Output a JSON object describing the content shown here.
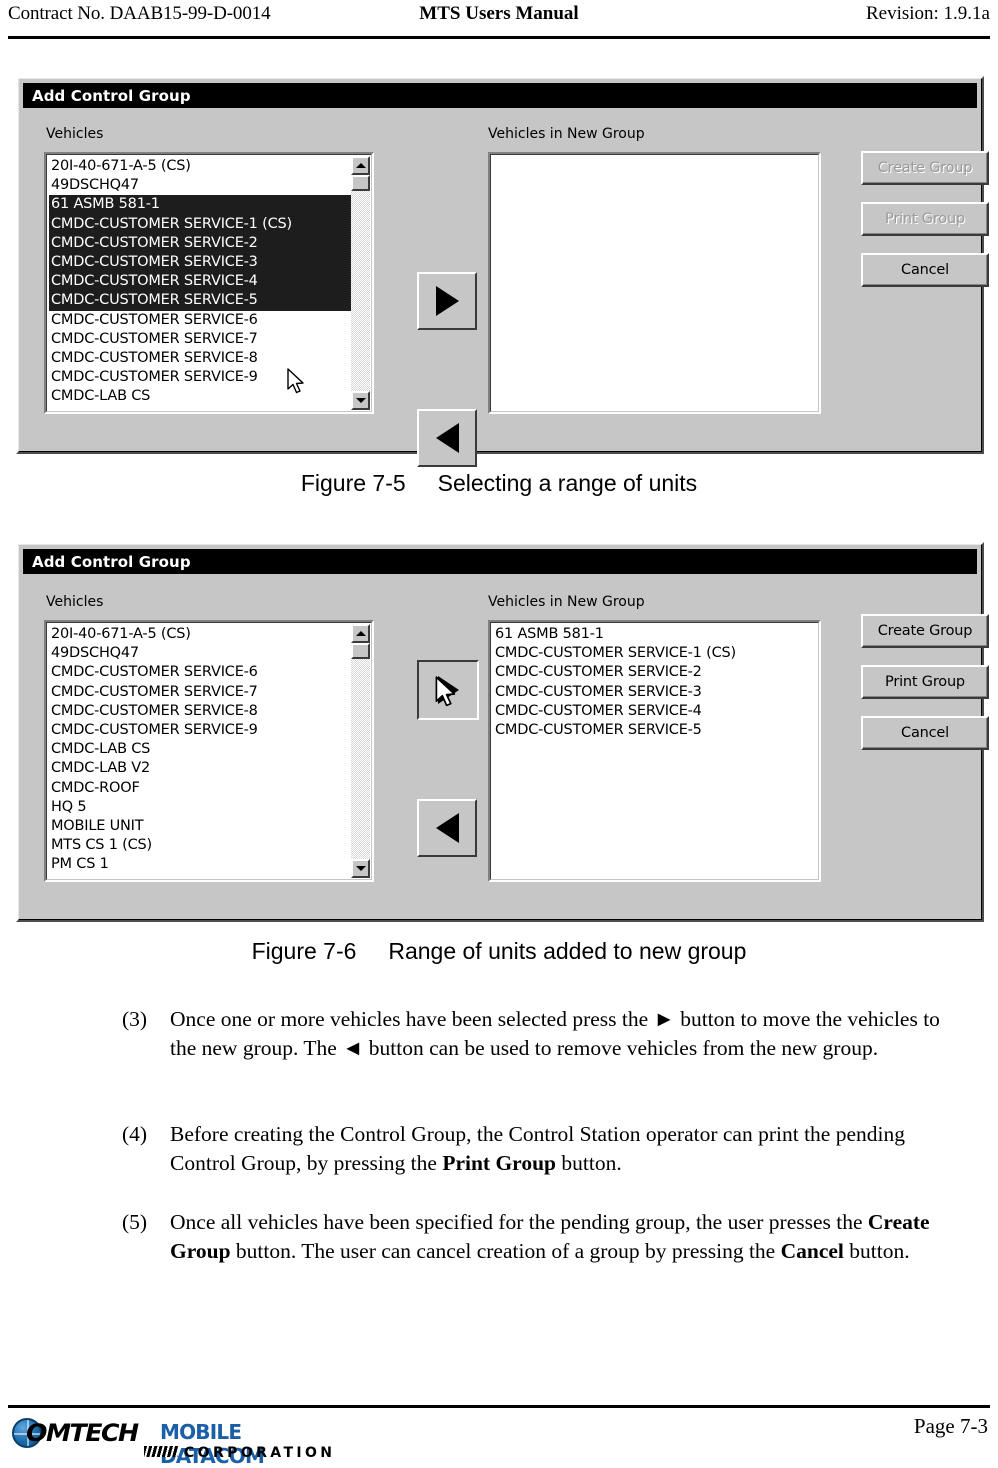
{
  "header": {
    "left": "Contract No. DAAB15-99-D-0014",
    "center": "MTS Users Manual",
    "right": "Revision:  1.9.1a"
  },
  "figure1": {
    "title": "Add Control Group",
    "left_label": "Vehicles",
    "right_label": "Vehicles in New Group",
    "left_items": [
      {
        "text": "20I-40-671-A-5 (CS)",
        "selected": false
      },
      {
        "text": "49DSCHQ47",
        "selected": false
      },
      {
        "text": "61 ASMB 581-1",
        "selected": true
      },
      {
        "text": "CMDC-CUSTOMER SERVICE-1 (CS)",
        "selected": true
      },
      {
        "text": "CMDC-CUSTOMER SERVICE-2",
        "selected": true
      },
      {
        "text": "CMDC-CUSTOMER SERVICE-3",
        "selected": true
      },
      {
        "text": "CMDC-CUSTOMER SERVICE-4",
        "selected": true
      },
      {
        "text": "CMDC-CUSTOMER SERVICE-5",
        "selected": true
      },
      {
        "text": "CMDC-CUSTOMER SERVICE-6",
        "selected": false
      },
      {
        "text": "CMDC-CUSTOMER SERVICE-7",
        "selected": false
      },
      {
        "text": "CMDC-CUSTOMER SERVICE-8",
        "selected": false
      },
      {
        "text": "CMDC-CUSTOMER SERVICE-9",
        "selected": false
      },
      {
        "text": "CMDC-LAB CS",
        "selected": false
      }
    ],
    "right_items": [],
    "buttons": {
      "create": "Create Group",
      "print": "Print Group",
      "cancel": "Cancel",
      "create_enabled": false,
      "print_enabled": false,
      "cancel_enabled": true
    },
    "move_right_icon": "triangle-right-icon",
    "move_left_icon": "triangle-left-icon",
    "caption": "Figure 7-5     Selecting a range of units"
  },
  "figure2": {
    "title": "Add Control Group",
    "left_label": "Vehicles",
    "right_label": "Vehicles in New Group",
    "left_items": [
      {
        "text": "20I-40-671-A-5 (CS)",
        "selected": false
      },
      {
        "text": "49DSCHQ47",
        "selected": false
      },
      {
        "text": "CMDC-CUSTOMER SERVICE-6",
        "selected": false
      },
      {
        "text": "CMDC-CUSTOMER SERVICE-7",
        "selected": false
      },
      {
        "text": "CMDC-CUSTOMER SERVICE-8",
        "selected": false
      },
      {
        "text": "CMDC-CUSTOMER SERVICE-9",
        "selected": false
      },
      {
        "text": "CMDC-LAB CS",
        "selected": false
      },
      {
        "text": "CMDC-LAB V2",
        "selected": false
      },
      {
        "text": "CMDC-ROOF",
        "selected": false
      },
      {
        "text": "HQ 5",
        "selected": false
      },
      {
        "text": "MOBILE UNIT",
        "selected": false
      },
      {
        "text": "MTS CS 1 (CS)",
        "selected": false
      },
      {
        "text": "PM CS 1",
        "selected": false
      }
    ],
    "right_items": [
      {
        "text": "61 ASMB 581-1",
        "selected": false
      },
      {
        "text": "CMDC-CUSTOMER SERVICE-1 (CS)",
        "selected": false
      },
      {
        "text": "CMDC-CUSTOMER SERVICE-2",
        "selected": false
      },
      {
        "text": "CMDC-CUSTOMER SERVICE-3",
        "selected": false
      },
      {
        "text": "CMDC-CUSTOMER SERVICE-4",
        "selected": false
      },
      {
        "text": "CMDC-CUSTOMER SERVICE-5",
        "selected": false
      }
    ],
    "buttons": {
      "create": "Create Group",
      "print": "Print Group",
      "cancel": "Cancel",
      "create_enabled": true,
      "print_enabled": true,
      "cancel_enabled": true
    },
    "move_right_icon": "triangle-right-icon",
    "move_left_icon": "triangle-left-icon",
    "caption": "Figure 7-6     Range of units added to new group"
  },
  "body": {
    "item3_num": "(3)",
    "item3_text": "Once one or more vehicles have been selected press the ► button to move the vehicles to the new group.  The ◄ button can be used to remove vehicles from the new group.",
    "item4_num": "(4)",
    "item4_pre": "Before creating the Control Group, the Control Station operator can print the pending Control Group, by pressing the ",
    "item4_bold": "Print Group",
    "item4_post": " button.",
    "item5_num": "(5)",
    "item5_pre": "Once all vehicles have been specified for the pending group, the user presses the ",
    "item5_bold1": "Create Group",
    "item5_mid": " button.  The user can cancel creation of a group by pressing the ",
    "item5_bold2": "Cancel",
    "item5_post": " button."
  },
  "footer": {
    "page": "Page 7-3",
    "logo_comtech": "OMTECH",
    "logo_mobile_datacom": "MOBILE DATACOM",
    "logo_corporation": "CORPORATION"
  },
  "colors": {
    "dialog_face": "#c6c6c6",
    "titlebar_bg": "#000000",
    "titlebar_fg": "#ffffff",
    "selection_bg": "#1d1d1d",
    "logo_blue": "#1a5fa8"
  }
}
